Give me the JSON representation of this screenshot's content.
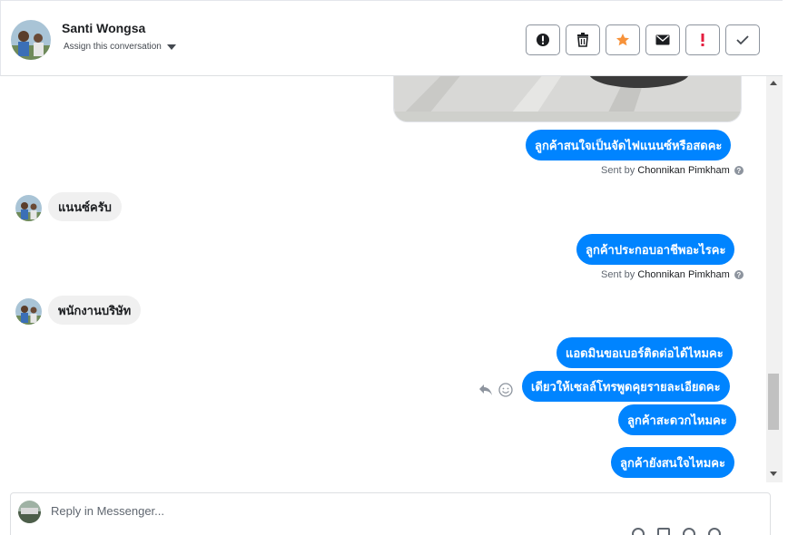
{
  "contact": {
    "name": "Santi Wongsa",
    "assign_label": "Assign this conversation"
  },
  "actions": [
    {
      "name": "alert-icon",
      "glyph": "!"
    },
    {
      "name": "trash-icon",
      "glyph": ""
    },
    {
      "name": "star-icon",
      "glyph": "★"
    },
    {
      "name": "envelope-icon",
      "glyph": ""
    },
    {
      "name": "exclamation-icon",
      "glyph": "!"
    },
    {
      "name": "checkmark-icon",
      "glyph": "✓"
    }
  ],
  "messages": {
    "m1": "ลูกค้าสนใจเป็นจัดไฟแนนซ์หรือสดคะ",
    "m2": "แนนซ์ครับ",
    "m3": "ลูกค้าประกอบอาชีพอะไรคะ",
    "m4": "พนักงานบริษัท",
    "m5": "แอดมินขอเบอร์ติดต่อได้ไหมคะ",
    "m6": "เดียวให้เซลล์โทรพูดคุยรายละเอียดคะ",
    "m7": "ลูกค้าสะดวกไหมคะ",
    "m8": "ลูกค้ายังสนใจไหมคะ"
  },
  "sent_by": {
    "prefix": "Sent by",
    "agent": "Chonnikan Pimkham"
  },
  "reply": {
    "placeholder": "Reply in Messenger..."
  },
  "colors": {
    "accent": "#0084ff",
    "star": "#f7923a",
    "flag": "#e41e3f"
  }
}
